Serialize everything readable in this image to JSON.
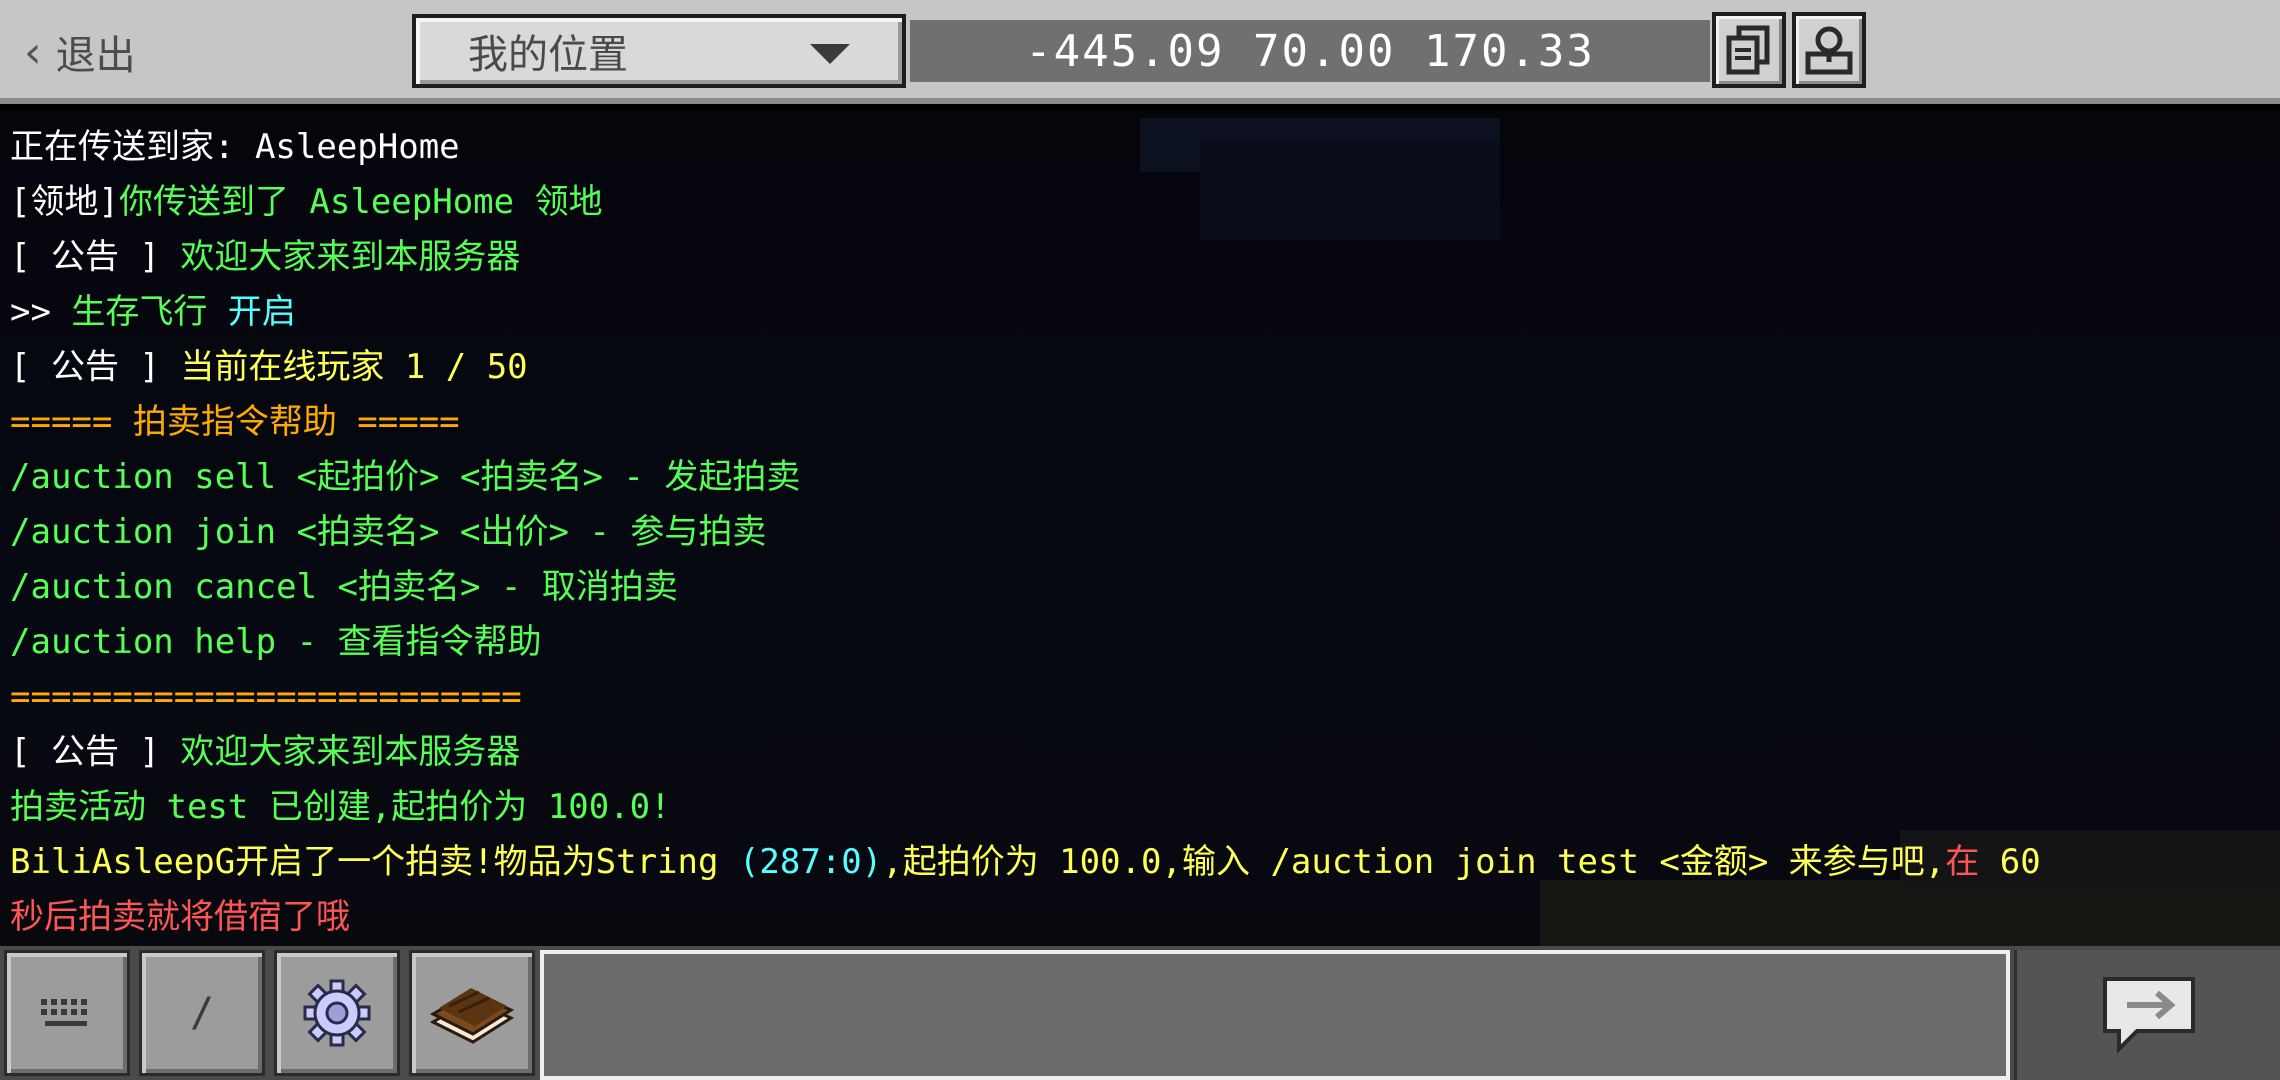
{
  "topbar": {
    "exit_label": "退出",
    "location_selected": "我的位置",
    "coordinates": "-445.09 70.00 170.33"
  },
  "chat": {
    "lines": [
      [
        {
          "t": "正在传送到家: AsleepHome",
          "c": "#ffffff"
        }
      ],
      [
        {
          "t": "[领地]",
          "c": "#ffffff"
        },
        {
          "t": "你传送到了 AsleepHome 领地",
          "c": "#55ff55"
        }
      ],
      [
        {
          "t": "[ 公告 ] ",
          "c": "#ffffff"
        },
        {
          "t": "欢迎大家来到本服务器",
          "c": "#55ff55"
        }
      ],
      [
        {
          "t": ">> ",
          "c": "#ffffff"
        },
        {
          "t": "生存飞行 ",
          "c": "#55ff55"
        },
        {
          "t": "开启",
          "c": "#55ffff"
        }
      ],
      [
        {
          "t": "[ 公告 ] ",
          "c": "#ffffff"
        },
        {
          "t": "当前在线玩家 1 / 50",
          "c": "#ffff55"
        }
      ],
      [
        {
          "t": "===== 拍卖指令帮助 =====",
          "c": "#ffaa00"
        }
      ],
      [
        {
          "t": "/auction sell <起拍价> <拍卖名> - 发起拍卖",
          "c": "#55ff55"
        }
      ],
      [
        {
          "t": "/auction join <拍卖名> <出价> - 参与拍卖",
          "c": "#55ff55"
        }
      ],
      [
        {
          "t": "/auction cancel <拍卖名> - 取消拍卖",
          "c": "#55ff55"
        }
      ],
      [
        {
          "t": "/auction help - 查看指令帮助",
          "c": "#55ff55"
        }
      ],
      [
        {
          "t": "=========================",
          "c": "#ffaa00"
        }
      ],
      [
        {
          "t": "[ 公告 ] ",
          "c": "#ffffff"
        },
        {
          "t": "欢迎大家来到本服务器",
          "c": "#55ff55"
        }
      ],
      [
        {
          "t": "拍卖活动 test 已创建,起拍价为 100.0!",
          "c": "#55ff55"
        }
      ],
      [
        {
          "t": "BiliAsleepG开启了一个拍卖!物品为String ",
          "c": "#ffff55"
        },
        {
          "t": "(287:0)",
          "c": "#55ffff"
        },
        {
          "t": ",起拍价为 100.0,输入 /auction join test <金额> 来参与吧,",
          "c": "#ffff55"
        },
        {
          "t": "在 ",
          "c": "#ff5555"
        },
        {
          "t": "60",
          "c": "#ffff55"
        }
      ],
      [
        {
          "t": "秒后拍卖就将借宿了哦",
          "c": "#ff5555"
        }
      ]
    ]
  },
  "bottombar": {
    "slash_label": "/",
    "input_value": "",
    "input_placeholder": ""
  }
}
